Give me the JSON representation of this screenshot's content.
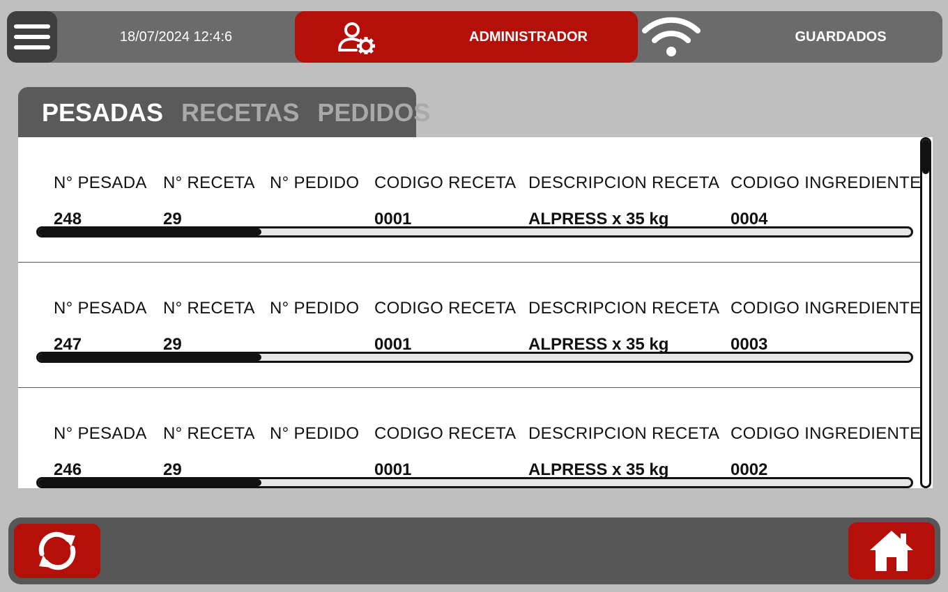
{
  "header": {
    "datetime": "18/07/2024 12:4:6",
    "user_role": "ADMINISTRADOR",
    "status": "GUARDADOS",
    "icons": {
      "menu": "hamburger-menu-icon",
      "user": "user-gear-icon",
      "wifi": "wifi-icon"
    }
  },
  "tabs": [
    {
      "label": "PESADAS",
      "active": true
    },
    {
      "label": "RECETAS",
      "active": false
    },
    {
      "label": "PEDIDOS",
      "active": false
    }
  ],
  "columns": [
    "N° PESADA",
    "N° RECETA",
    "N° PEDIDO",
    "CODIGO RECETA",
    "DESCRIPCION RECETA",
    "CODIGO INGREDIENTE"
  ],
  "records": [
    {
      "n_pesada": "248",
      "n_receta": "29",
      "n_pedido": "",
      "codigo_receta": "0001",
      "descripcion_receta": "ALPRESS x 35 kg",
      "codigo_ingrediente": "0004"
    },
    {
      "n_pesada": "247",
      "n_receta": "29",
      "n_pedido": "",
      "codigo_receta": "0001",
      "descripcion_receta": "ALPRESS x 35 kg",
      "codigo_ingrediente": "0003"
    },
    {
      "n_pesada": "246",
      "n_receta": "29",
      "n_pedido": "",
      "codigo_receta": "0001",
      "descripcion_receta": "ALPRESS x 35 kg",
      "codigo_ingrediente": "0002"
    }
  ],
  "footer": {
    "icons": {
      "refresh": "refresh-icon",
      "home": "home-icon"
    }
  },
  "colors": {
    "accent": "#b50f0a",
    "bar": "#6b6b6b",
    "background": "#bfbfbf"
  }
}
